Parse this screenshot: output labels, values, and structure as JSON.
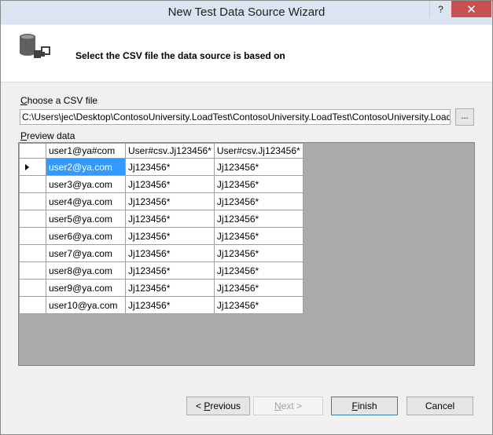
{
  "window": {
    "title": "New Test Data Source Wizard",
    "help_label": "?",
    "close_label": "✕"
  },
  "header": {
    "instruction": "Select the CSV file the data source is based on"
  },
  "csv": {
    "label_prefix": "C",
    "label_rest": "hoose a CSV file",
    "path": "C:\\Users\\jec\\Desktop\\ContosoUniversity.LoadTest\\ContosoUniversity.LoadTest\\ContosoUniversity.Load",
    "browse_label": "..."
  },
  "preview": {
    "label_prefix": "P",
    "label_rest": "review data",
    "columns": [
      "user1@ya#com",
      "User#csv.Jj123456*",
      "User#csv.Jj123456*"
    ],
    "rows": [
      [
        "user2@ya.com",
        "Jj123456*",
        "Jj123456*"
      ],
      [
        "user3@ya.com",
        "Jj123456*",
        "Jj123456*"
      ],
      [
        "user4@ya.com",
        "Jj123456*",
        "Jj123456*"
      ],
      [
        "user5@ya.com",
        "Jj123456*",
        "Jj123456*"
      ],
      [
        "user6@ya.com",
        "Jj123456*",
        "Jj123456*"
      ],
      [
        "user7@ya.com",
        "Jj123456*",
        "Jj123456*"
      ],
      [
        "user8@ya.com",
        "Jj123456*",
        "Jj123456*"
      ],
      [
        "user9@ya.com",
        "Jj123456*",
        "Jj123456*"
      ],
      [
        "user10@ya.com",
        "Jj123456*",
        "Jj123456*"
      ]
    ]
  },
  "buttons": {
    "previous_prefix": "< ",
    "previous_key": "P",
    "previous_rest": "revious",
    "next_key": "N",
    "next_rest": "ext >",
    "finish_key": "F",
    "finish_rest": "inish",
    "cancel_label": "Cancel"
  },
  "colors": {
    "selection": "#3399ff",
    "close_button": "#c75050",
    "grid_background": "#ababab"
  }
}
